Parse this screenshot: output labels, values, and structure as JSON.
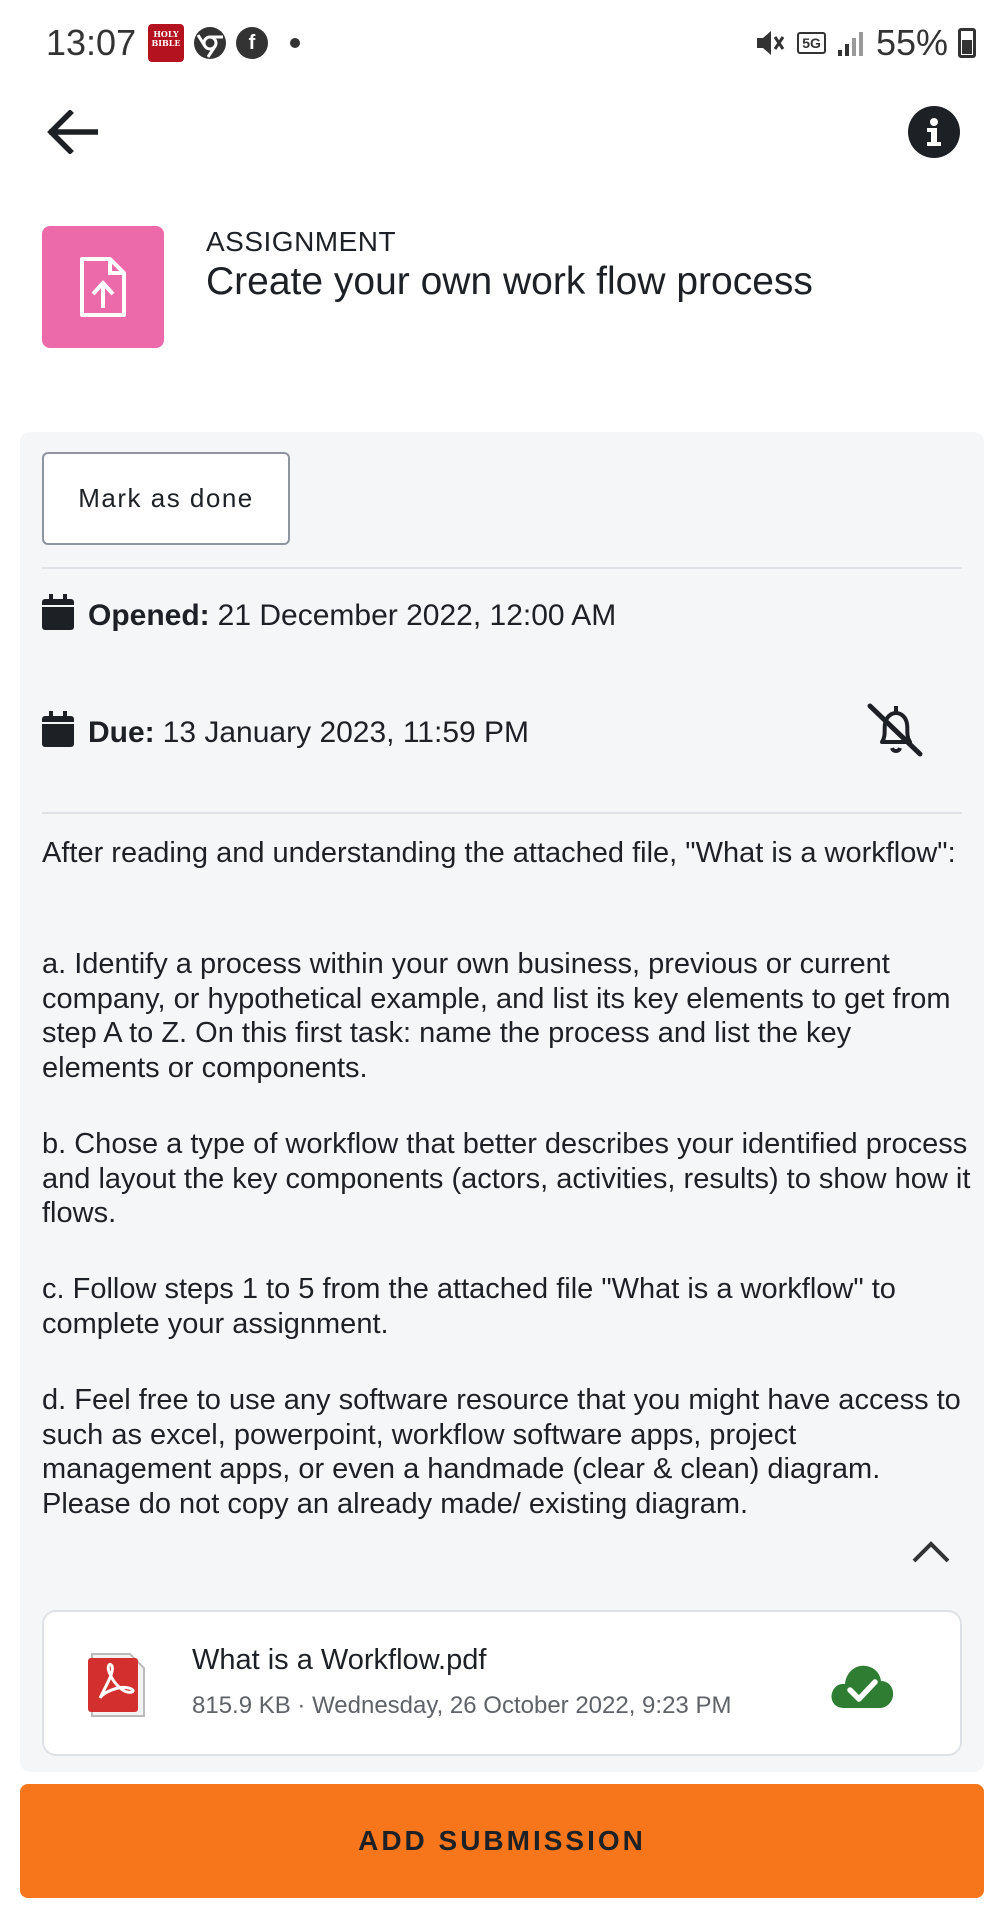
{
  "status_bar": {
    "time": "13:07",
    "bible_icon_text": "HOLY BIBLE",
    "network": "5G",
    "battery_percent": "55%",
    "left_icons": [
      "bible-app-icon",
      "chrome-icon",
      "facebook-icon",
      "notification-dot"
    ],
    "right_icons": [
      "mute-icon",
      "5g-icon",
      "signal-icon",
      "battery-icon"
    ]
  },
  "header": {
    "type_label": "ASSIGNMENT",
    "title": "Create your own work flow process",
    "icon": "file-upload-icon",
    "icon_color": "#ec6aa9"
  },
  "actions": {
    "mark_done_label": "Mark as done",
    "add_submission_label": "ADD SUBMISSION",
    "accent_color": "#f7761c"
  },
  "dates": {
    "opened_label": "Opened:",
    "opened_value": "21 December 2022, 12:00 AM",
    "due_label": "Due:",
    "due_value": "13 January 2023, 11:59 PM"
  },
  "description": {
    "intro": "After reading and understanding the attached file, \"What is a workflow\":",
    "a": "a. Identify a process within your own business, previous or current company, or hypothetical example, and list its key elements to get from step A to Z. On this first task: name the process and list the key elements or components.",
    "b": "b. Chose a type of workflow that better describes your identified process and layout the key components (actors, activities, results) to show how it flows.",
    "c": "c. Follow steps 1 to 5 from the attached file \"What is a workflow\" to complete your assignment.",
    "d": "d. Feel free to use any software resource that you might have access to such as excel, powerpoint, workflow software apps, project management apps, or even a handmade (clear & clean) diagram. Please do not copy an already made/ existing diagram."
  },
  "attachment": {
    "name": "What is a Workflow.pdf",
    "meta": "815.9 KB · Wednesday, 26 October 2022, 9:23 PM",
    "status_icon": "cloud-check-icon",
    "status_color": "#2e7d32"
  }
}
